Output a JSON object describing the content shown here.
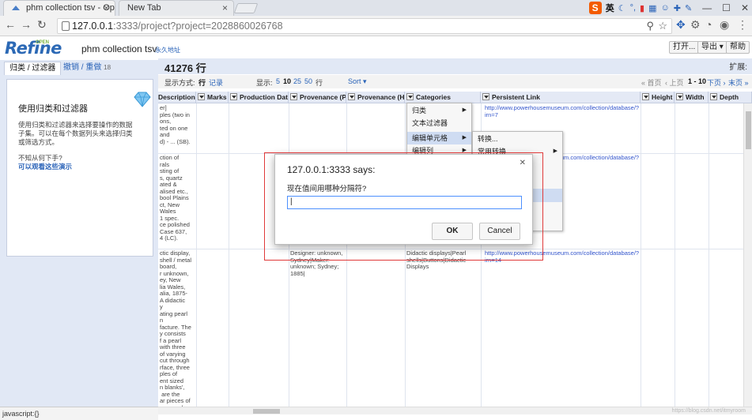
{
  "browser": {
    "tabs": [
      {
        "title": "phm collection tsv - Op",
        "active": true
      },
      {
        "title": "New Tab",
        "active": false
      }
    ],
    "url_host": "127.0.0.1",
    "url_rest": ":3333/project?project=2028860026768",
    "ime_label": "英"
  },
  "header": {
    "logo": "Refine",
    "logo_open": "OPEN",
    "project_name": "phm collection tsv",
    "permalink": "永久地址",
    "buttons": {
      "open": "打开...",
      "export": "导出",
      "help": "帮助"
    }
  },
  "left": {
    "tab_facets": "归类 / 过滤器",
    "tab_undo": "撤销 / 重做",
    "undo_count": "18",
    "help_title": "使用归类和过滤器",
    "help_text": "使用归类和过滤器来选择要操作的数据子集。可以在每个数据列头来选择归类或筛选方式。",
    "help_question": "不知从何下手?",
    "help_link": "可以观看这些演示"
  },
  "main": {
    "rows_label": "41276 行",
    "expand_label": "扩展:",
    "show_as": "显示方式:",
    "mode_rows": "行",
    "mode_records": "记录",
    "show_label": "显示:",
    "page_sizes": [
      "5",
      "10",
      "25",
      "50"
    ],
    "page_size_unit": "行",
    "sort_label": "Sort",
    "pager": {
      "first": "« 首页",
      "prev": "‹ 上页",
      "range": "1 - 10",
      "next": "下页 ›",
      "last": "末页 »"
    }
  },
  "columns": [
    "Description.",
    "Marks",
    "Production Date",
    "Provenance (Pro",
    "Provenance (His",
    "Categories",
    "Persistent Link",
    "Height",
    "Width",
    "Depth"
  ],
  "cells": {
    "desc1": "er]\nples (two in\nons,\nted on one\nand\nd) - ... (SB).",
    "desc2": "ction of\nrals\nsting of\ns, quartz\nated &\nalised etc.,\nbool Plains\nct, New\nWales\n1 spec.\nce polished\nCase 637,\n4 (LC).",
    "desc3": "ctic display,\nshell / metal\nboard,\nr unknown,\ney, New\nlia Wales,\nalia, 1875-\nA didactic\ny\nating pearl\nn\nfacture. The\ny consists\nf a pearl\nwith three\nof varying\ncut through\nrface, three\nples of\nent sized\nn blanks',\n are the\nar pieces of\nremoved",
    "prov3": "Designer: unknown,\nSydney|Maker:\nunknown; Sydney;\n1885|",
    "cat3": "Didactic displays|Pearl\nshells|Buttons|Didactic\nDisplays",
    "link1": "http://www.powerhousemuseum.com/collection/database/?\nirn=7",
    "link2": "http://www.powerhousemuseum.com/collection/database/?",
    "link3": "http://www.powerhousemuseum.com/collection/database/?\nirn=14"
  },
  "menu": {
    "items": [
      "归类",
      "文本过滤器",
      "编辑单元格",
      "编辑列"
    ],
    "submenu": [
      "转换...",
      "常用转换"
    ]
  },
  "dialog": {
    "title": "127.0.0.1:3333 says:",
    "message": "现在值间用哪种分隔符?",
    "input_value": "|",
    "ok": "OK",
    "cancel": "Cancel"
  },
  "status": "javascript:{}",
  "watermark": "https://blog.csdn.net/itmyroom"
}
